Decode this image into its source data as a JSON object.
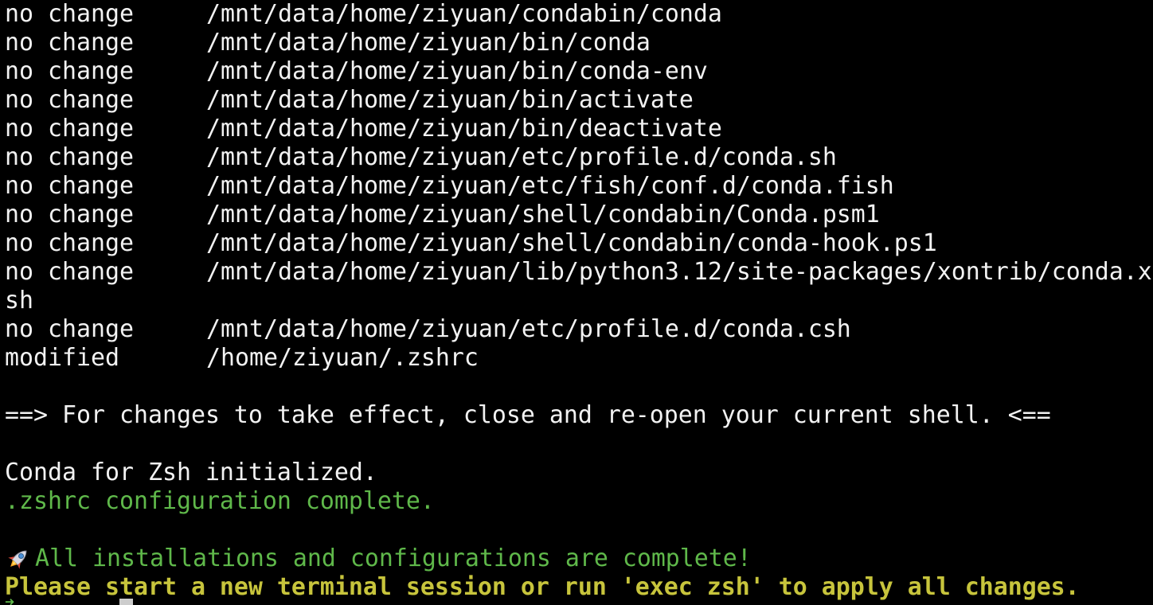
{
  "rows": [
    {
      "status": "no change",
      "path": "/mnt/data/home/ziyuan/condabin/conda"
    },
    {
      "status": "no change",
      "path": "/mnt/data/home/ziyuan/bin/conda"
    },
    {
      "status": "no change",
      "path": "/mnt/data/home/ziyuan/bin/conda-env"
    },
    {
      "status": "no change",
      "path": "/mnt/data/home/ziyuan/bin/activate"
    },
    {
      "status": "no change",
      "path": "/mnt/data/home/ziyuan/bin/deactivate"
    },
    {
      "status": "no change",
      "path": "/mnt/data/home/ziyuan/etc/profile.d/conda.sh"
    },
    {
      "status": "no change",
      "path": "/mnt/data/home/ziyuan/etc/fish/conf.d/conda.fish"
    },
    {
      "status": "no change",
      "path": "/mnt/data/home/ziyuan/shell/condabin/Conda.psm1"
    },
    {
      "status": "no change",
      "path": "/mnt/data/home/ziyuan/shell/condabin/conda-hook.ps1"
    },
    {
      "status": "no change",
      "path": "/mnt/data/home/ziyuan/lib/python3.12/site-packages/xontrib/conda.x"
    },
    {
      "status": "",
      "path": "sh"
    },
    {
      "status": "no change",
      "path": "/mnt/data/home/ziyuan/etc/profile.d/conda.csh"
    },
    {
      "status": "modified",
      "path": "/home/ziyuan/.zshrc"
    }
  ],
  "effect_notice": "==> For changes to take effect, close and re-open your current shell. <==",
  "conda_init": "Conda for Zsh initialized.",
  "zshrc_complete": ".zshrc configuration complete.",
  "all_complete": "All installations and configurations are complete!",
  "restart_notice": "Please start a new terminal session or run 'exec zsh' to apply all changes.",
  "icons": {
    "rocket": "rocket-icon",
    "cursor": "block-cursor"
  },
  "colors": {
    "background": "#000000",
    "text": "#f2f2f2",
    "green": "#5fb84a",
    "yellow": "#c7c43c"
  }
}
